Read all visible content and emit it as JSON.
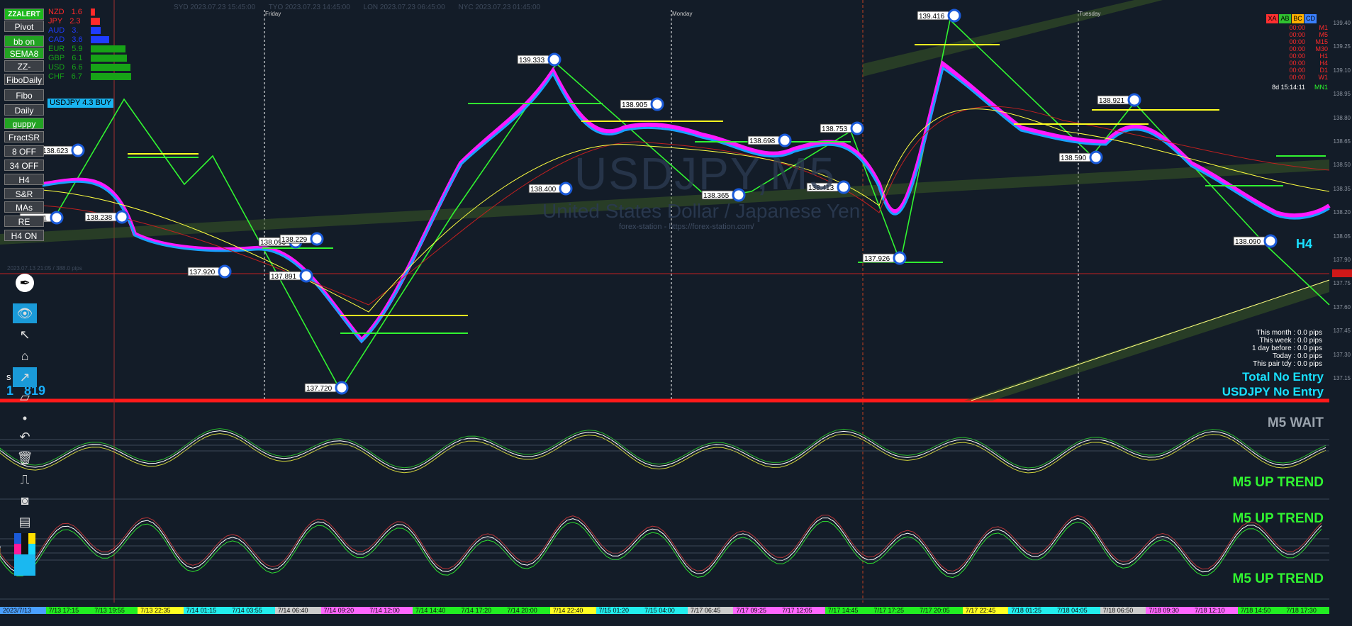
{
  "sessions": [
    "SYD 2023.07.23 15:45:00",
    "TYO 2023.07.23 14:45:00",
    "LON 2023.07.23 06:45:00",
    "NYC 2023.07.23 01:45:00"
  ],
  "day_separators": [
    "Friday",
    "Monday",
    "Tuesday"
  ],
  "watermark": {
    "symbol": "USDJPY,M5",
    "description": "United States Dollar / Japanese Yen",
    "url": "forex-station - https://forex-station.com/"
  },
  "left_buttons": [
    "ZZALERT",
    "Pivot",
    "bb on",
    "SEMA8",
    "ZZ-HH_LL",
    "FiboDaily",
    "Fibo",
    "Daily Open",
    "guppy",
    "FractSR",
    "8 OFF",
    "34 OFF",
    "H4",
    "S&R",
    "MAs Slide",
    "RE",
    "H4 ON"
  ],
  "currency_strength": [
    {
      "code": "NZD",
      "value": "1.6",
      "color": "#ff2a2a"
    },
    {
      "code": "JPY",
      "value": "2.3",
      "color": "#ff2a2a"
    },
    {
      "code": "AUD",
      "value": "3.",
      "color": "#1f3cff"
    },
    {
      "code": "CAD",
      "value": "3.6",
      "color": "#1f3cff"
    },
    {
      "code": "EUR",
      "value": "5.9",
      "color": "#17a317"
    },
    {
      "code": "GBP",
      "value": "6.1",
      "color": "#17a317"
    },
    {
      "code": "USD",
      "value": "6.6",
      "color": "#17a317"
    },
    {
      "code": "CHF",
      "value": "6.7",
      "color": "#17a317"
    }
  ],
  "signal_badge": "USDJPY 4.3 BUY",
  "abc_tabs": [
    {
      "label": "XA",
      "color": "#ff3030"
    },
    {
      "label": "AB",
      "color": "#30c030"
    },
    {
      "label": "BC",
      "color": "#ffb000"
    },
    {
      "label": "CD",
      "color": "#3a80ff"
    }
  ],
  "timeframes": [
    {
      "time": "00:00",
      "tf": "M1",
      "active": false
    },
    {
      "time": "00:00",
      "tf": "M5",
      "active": false
    },
    {
      "time": "00:00",
      "tf": "M15",
      "active": false
    },
    {
      "time": "00:00",
      "tf": "M30",
      "active": false
    },
    {
      "time": "00:00",
      "tf": "H1",
      "active": false
    },
    {
      "time": "00:00",
      "tf": "H4",
      "active": false
    },
    {
      "time": "00:00",
      "tf": "D1",
      "active": false
    },
    {
      "time": "00:00",
      "tf": "W1",
      "active": false
    },
    {
      "time": "8d 15:14:11",
      "tf": "MN1",
      "active": true
    }
  ],
  "stats": [
    "This month : 0.0 pips",
    "This week : 0.0 pips",
    "1 day before : 0.0 pips",
    "Today : 0.0 pips",
    "This pair tdy : 0.0 pips"
  ],
  "status": {
    "total": "Total No Entry",
    "pair": "USDJPY No Entry",
    "m5_wait": "M5 WAIT",
    "trend1": "M5 UP TREND",
    "trend2": "M5 UP TREND",
    "trend3": "M5 UP TREND"
  },
  "partial_left": {
    "spread": "s    8.5",
    "price": "1   819"
  },
  "range_label": "2023.07.13 21:05 / 388.0 pips",
  "h4_label": "H4",
  "zz_labels": [
    {
      "text": "138.623"
    },
    {
      "text": "138.238"
    },
    {
      "text": "138.231"
    },
    {
      "text": "137.920"
    },
    {
      "text": "138.093"
    },
    {
      "text": "138.229"
    },
    {
      "text": "137.891"
    },
    {
      "text": "137.720"
    },
    {
      "text": "139.333"
    },
    {
      "text": "138.400"
    },
    {
      "text": "138.905"
    },
    {
      "text": "138.365"
    },
    {
      "text": "138.698"
    },
    {
      "text": "138.753"
    },
    {
      "text": "138.413"
    },
    {
      "text": "137.926"
    },
    {
      "text": "139.416"
    },
    {
      "text": "138.921"
    },
    {
      "text": "138.590"
    },
    {
      "text": "138.090"
    }
  ],
  "price_scale": [
    "139.40",
    "139.25",
    "139.10",
    "138.95",
    "138.80",
    "138.65",
    "138.50",
    "138.35",
    "138.20",
    "138.05",
    "137.90",
    "137.75",
    "137.60",
    "137.45",
    "137.30",
    "137.15"
  ],
  "time_axis": [
    {
      "label": "2023/7/13",
      "color": "#4aa0ff"
    },
    {
      "label": "7/13 17:15",
      "color": "#22ee22"
    },
    {
      "label": "7/13 19:55",
      "color": "#22ee22"
    },
    {
      "label": "7/13 22:35",
      "color": "#ffff22"
    },
    {
      "label": "7/14 01:15",
      "color": "#22eeee"
    },
    {
      "label": "7/14 03:55",
      "color": "#22eeee"
    },
    {
      "label": "7/14 06:40",
      "color": "#cccccc"
    },
    {
      "label": "7/14 09:20",
      "color": "#ff66ff"
    },
    {
      "label": "7/14 12:00",
      "color": "#ff66ff"
    },
    {
      "label": "7/14 14:40",
      "color": "#22ee22"
    },
    {
      "label": "7/14 17:20",
      "color": "#22ee22"
    },
    {
      "label": "7/14 20:00",
      "color": "#22ee22"
    },
    {
      "label": "7/14 22:40",
      "color": "#ffff22"
    },
    {
      "label": "7/15 01:20",
      "color": "#22eeee"
    },
    {
      "label": "7/15 04:00",
      "color": "#22eeee"
    },
    {
      "label": "7/17 06:45",
      "color": "#cccccc"
    },
    {
      "label": "7/17 09:25",
      "color": "#ff66ff"
    },
    {
      "label": "7/17 12:05",
      "color": "#ff66ff"
    },
    {
      "label": "7/17 14:45",
      "color": "#22ee22"
    },
    {
      "label": "7/17 17:25",
      "color": "#22ee22"
    },
    {
      "label": "7/17 20:05",
      "color": "#22ee22"
    },
    {
      "label": "7/17 22:45",
      "color": "#ffff22"
    },
    {
      "label": "7/18 01:25",
      "color": "#22eeee"
    },
    {
      "label": "7/18 04:05",
      "color": "#22eeee"
    },
    {
      "label": "7/18 06:50",
      "color": "#cccccc"
    },
    {
      "label": "7/18 09:30",
      "color": "#ff66ff"
    },
    {
      "label": "7/18 12:10",
      "color": "#ff66ff"
    },
    {
      "label": "7/18 14:50",
      "color": "#22ee22"
    },
    {
      "label": "7/18 17:30",
      "color": "#22ee22"
    }
  ],
  "toolbar_tools": [
    "pen-icon",
    "eye-icon",
    "cursor-icon",
    "tag-icon",
    "trendline-icon",
    "eraser-icon",
    "dot-icon",
    "undo-icon",
    "trash-icon",
    "train-icon",
    "camera-icon",
    "clipboard-icon",
    "color-palette-icon"
  ],
  "colors": {
    "background": "#131c28",
    "red_line": "#ff1a1a",
    "magenta": "#ff19ff",
    "lime": "#31f531",
    "cyan": "#19e0ff"
  }
}
